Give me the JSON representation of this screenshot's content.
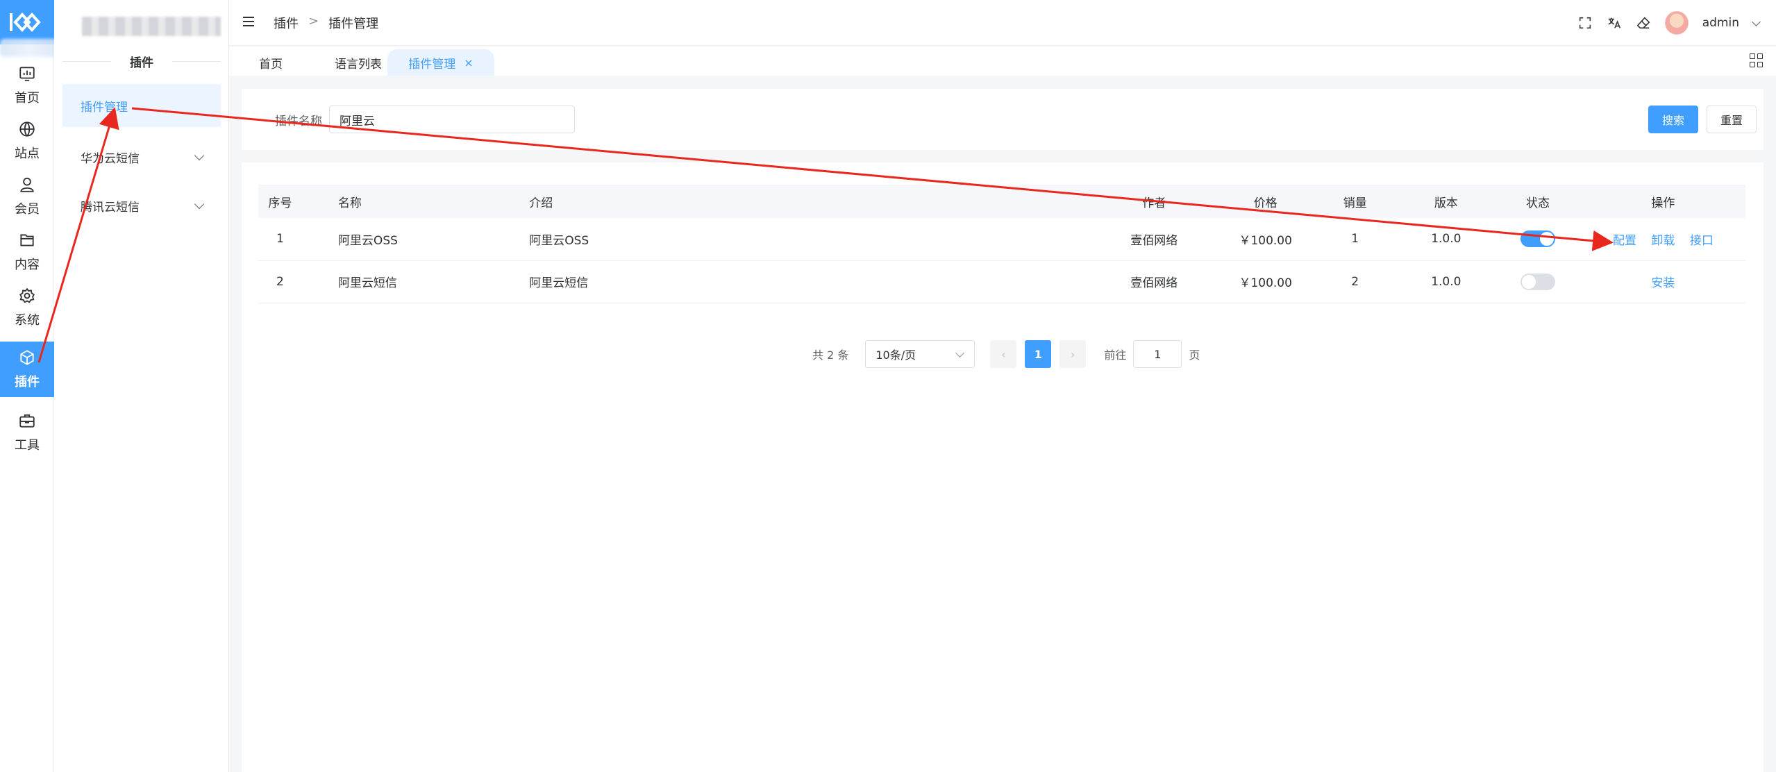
{
  "rail": {
    "items": [
      {
        "label": "首页",
        "icon": "dashboard-icon"
      },
      {
        "label": "站点",
        "icon": "globe-icon"
      },
      {
        "label": "会员",
        "icon": "user-icon"
      },
      {
        "label": "内容",
        "icon": "folder-icon"
      },
      {
        "label": "系统",
        "icon": "gear-icon"
      },
      {
        "label": "插件",
        "icon": "cube-icon",
        "active": true
      },
      {
        "label": "工具",
        "icon": "toolbox-icon"
      }
    ]
  },
  "submenu": {
    "heading": "插件",
    "items": [
      {
        "label": "插件管理",
        "active": true
      },
      {
        "label": "华为云短信"
      },
      {
        "label": "腾讯云短信"
      }
    ]
  },
  "header": {
    "breadcrumb": [
      "插件",
      ">",
      "插件管理"
    ],
    "user": "admin"
  },
  "tabs": [
    {
      "label": "首页"
    },
    {
      "label": "语言列表"
    },
    {
      "label": "插件管理",
      "close": "×",
      "active": true
    }
  ],
  "search": {
    "label": "插件名称",
    "value": "阿里云",
    "search_button": "搜索",
    "reset_button": "重置"
  },
  "table": {
    "columns": [
      "序号",
      "名称",
      "介绍",
      "作者",
      "价格",
      "销量",
      "版本",
      "状态",
      "操作"
    ],
    "rows": [
      {
        "index": "1",
        "name": "阿里云OSS",
        "intro": "阿里云OSS",
        "author": "壹佰网络",
        "price": "￥100.00",
        "sales": "1",
        "version": "1.0.0",
        "enabled": true,
        "actions": [
          "配置",
          "卸载",
          "接口"
        ]
      },
      {
        "index": "2",
        "name": "阿里云短信",
        "intro": "阿里云短信",
        "author": "壹佰网络",
        "price": "￥100.00",
        "sales": "2",
        "version": "1.0.0",
        "enabled": false,
        "actions": [
          "安装"
        ]
      }
    ]
  },
  "pagination": {
    "total": "共 2 条",
    "page_size": "10条/页",
    "prev": "‹",
    "current": "1",
    "next": "›",
    "goto_label": "前往",
    "goto_value": "1",
    "page_suffix": "页"
  },
  "colors": {
    "primary": "#409eff",
    "annotation": "#e8281e"
  }
}
